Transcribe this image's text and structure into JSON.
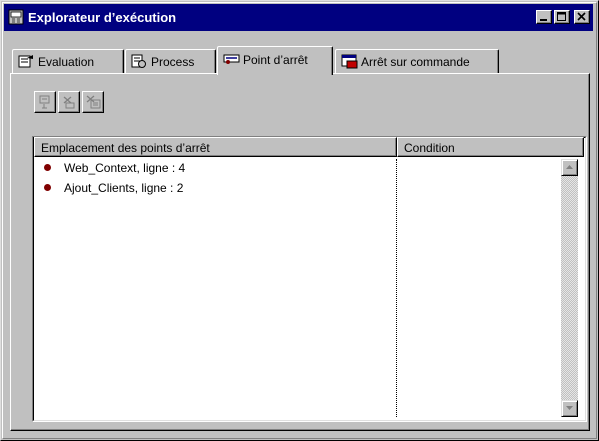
{
  "window": {
    "title": "Explorateur d’exécution",
    "title_icon": "debugger-window-icon",
    "title_bg": "#000080"
  },
  "titlebar_buttons": [
    {
      "name": "minimize-button",
      "icon": "minimize-icon"
    },
    {
      "name": "maximize-button",
      "icon": "maximize-icon"
    },
    {
      "name": "close-button",
      "icon": "close-icon"
    }
  ],
  "tabs": [
    {
      "label": "Evaluation",
      "icon": "evaluation-icon",
      "active": false
    },
    {
      "label": "Process",
      "icon": "process-icon",
      "active": false
    },
    {
      "label": "Point d’arrêt",
      "icon": "breakpoint-icon",
      "active": true
    },
    {
      "label": "Arrêt sur commande",
      "icon": "stop-on-command-icon",
      "active": false
    }
  ],
  "toolbar": [
    {
      "icon": "go-to-breakpoint-icon",
      "enabled": false
    },
    {
      "icon": "delete-breakpoint-icon",
      "enabled": false
    },
    {
      "icon": "delete-all-breakpoints-icon",
      "enabled": false
    }
  ],
  "breakpoints": {
    "columns": [
      "Emplacement des points d’arrêt",
      "Condition"
    ],
    "rows": [
      {
        "location": "Web_Context, ligne : 4",
        "condition": ""
      },
      {
        "location": "Ajout_Clients, ligne : 2",
        "condition": ""
      }
    ],
    "marker_color": "#800000"
  }
}
